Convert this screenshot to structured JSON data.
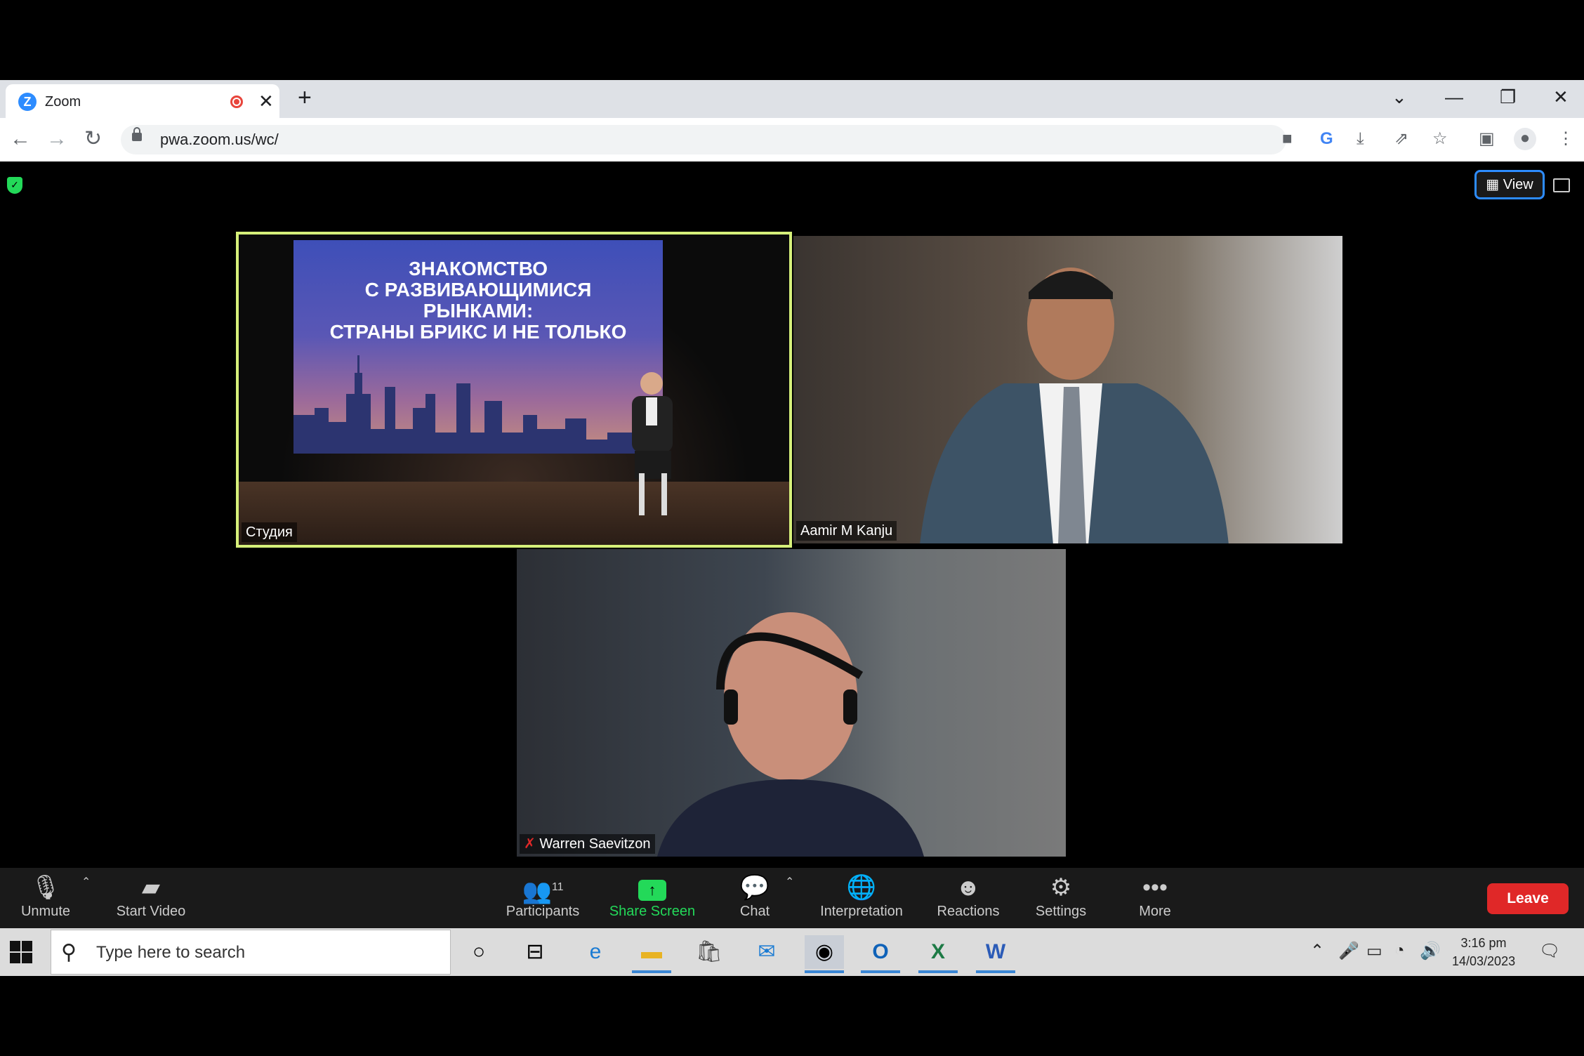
{
  "browser": {
    "tab_title": "Zoom",
    "tab_logo": "Z",
    "url": "pwa.zoom.us/wc/",
    "icons": [
      "back-icon",
      "forward-icon",
      "reload-icon",
      "camera-icon",
      "google-icon",
      "install-icon",
      "share-icon",
      "star-icon",
      "sidepanel-icon",
      "profile-icon",
      "menu-icon"
    ]
  },
  "zoom": {
    "view_label": "View",
    "videos": [
      {
        "name": "Студия",
        "slide_text": [
          "ЗНАКОМСТВО",
          "С РАЗВИВАЮЩИМИСЯ",
          "РЫНКАМИ:",
          "СТРАНЫ БРИКС И НЕ ТОЛЬКО"
        ]
      },
      {
        "name": "Aamir M Kanju"
      },
      {
        "name": "Warren Saevitzon"
      }
    ],
    "toolbar": {
      "unmute": "Unmute",
      "start_video": "Start Video",
      "participants": "Participants",
      "participants_count": "11",
      "share_screen": "Share Screen",
      "chat": "Chat",
      "interpretation": "Interpretation",
      "reactions": "Reactions",
      "settings": "Settings",
      "more": "More",
      "leave": "Leave"
    },
    "accent": "#2d8cff",
    "leave_color": "#e02828",
    "share_color": "#23d959"
  },
  "taskbar": {
    "search_placeholder": "Type here to search",
    "time": "3:16 pm",
    "date": "14/03/2023"
  }
}
